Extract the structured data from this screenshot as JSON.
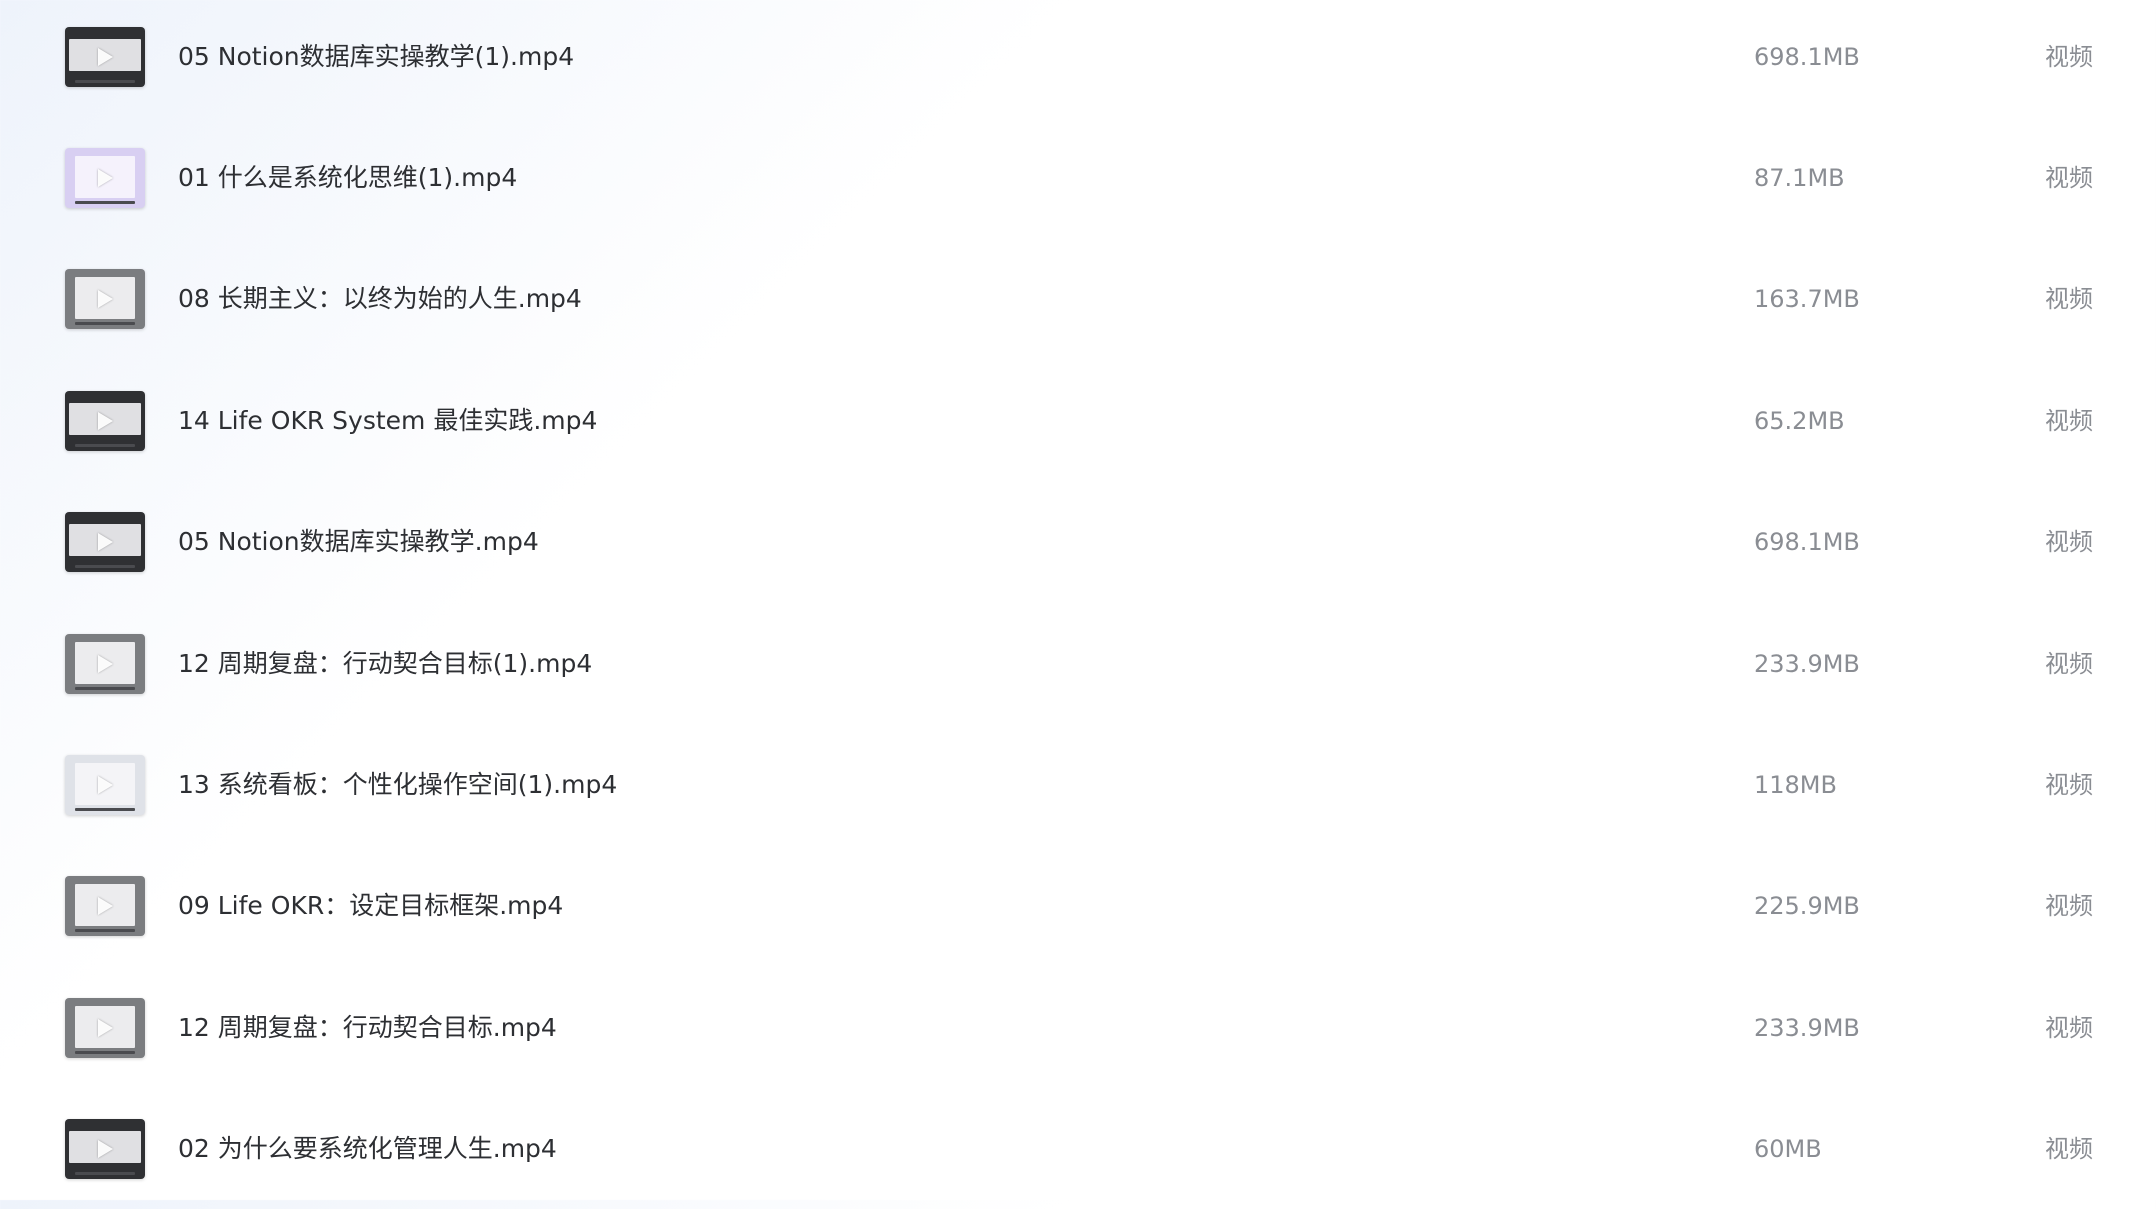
{
  "files": [
    {
      "name": "05 Notion数据库实操教学(1).mp4",
      "size": "698.1MB",
      "type": "视频",
      "thumb_style": "dark",
      "thumbnail_icon": "play-icon"
    },
    {
      "name": "01 什么是系统化思维(1).mp4",
      "size": "87.1MB",
      "type": "视频",
      "thumb_style": "lilac",
      "thumbnail_icon": "play-icon"
    },
    {
      "name": "08 长期主义：以终为始的人生.mp4",
      "size": "163.7MB",
      "type": "视频",
      "thumb_style": "gray",
      "thumbnail_icon": "play-icon"
    },
    {
      "name": "14 Life OKR System 最佳实践.mp4",
      "size": "65.2MB",
      "type": "视频",
      "thumb_style": "dark",
      "thumbnail_icon": "play-icon"
    },
    {
      "name": "05 Notion数据库实操教学.mp4",
      "size": "698.1MB",
      "type": "视频",
      "thumb_style": "dark",
      "thumbnail_icon": "play-icon"
    },
    {
      "name": "12 周期复盘：行动契合目标(1).mp4",
      "size": "233.9MB",
      "type": "视频",
      "thumb_style": "gray",
      "thumbnail_icon": "play-icon"
    },
    {
      "name": "13 系统看板：个性化操作空间(1).mp4",
      "size": "118MB",
      "type": "视频",
      "thumb_style": "light",
      "thumbnail_icon": "play-icon"
    },
    {
      "name": "09 Life OKR：设定目标框架.mp4",
      "size": "225.9MB",
      "type": "视频",
      "thumb_style": "gray",
      "thumbnail_icon": "play-icon"
    },
    {
      "name": "12 周期复盘：行动契合目标.mp4",
      "size": "233.9MB",
      "type": "视频",
      "thumb_style": "gray",
      "thumbnail_icon": "play-icon"
    },
    {
      "name": "02 为什么要系统化管理人生.mp4",
      "size": "60MB",
      "type": "视频",
      "thumb_style": "dark",
      "thumbnail_icon": "play-icon"
    }
  ]
}
